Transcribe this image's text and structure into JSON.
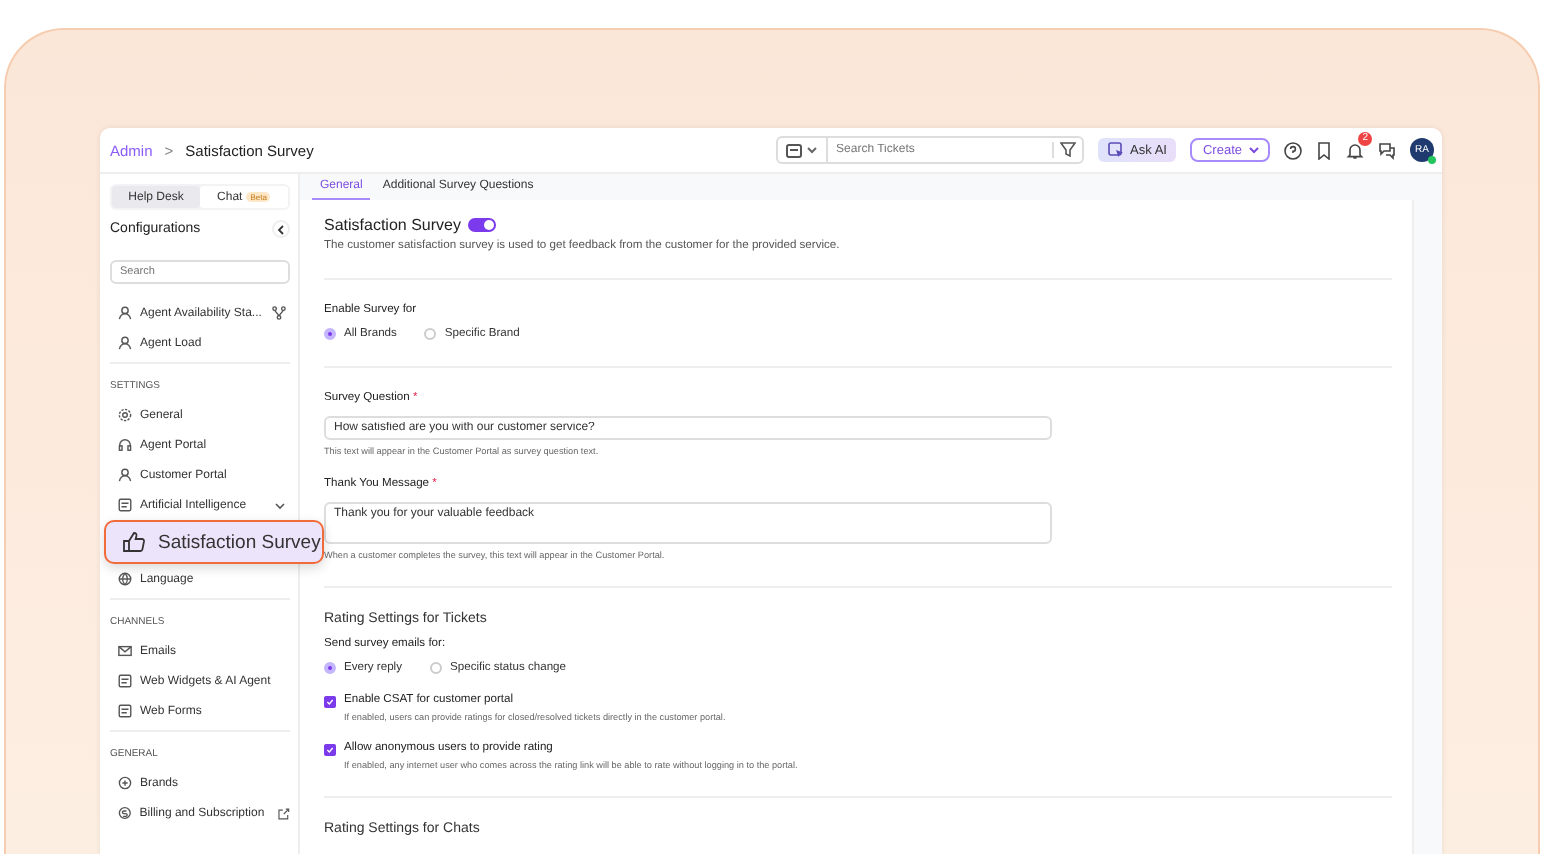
{
  "breadcrumb": {
    "parent": "Admin",
    "separator": ">",
    "current": "Satisfaction Survey"
  },
  "header": {
    "search": {
      "placeholder": "Search Tickets"
    },
    "ask_ai": "Ask AI",
    "create": "Create",
    "notifications_badge": "2",
    "avatar": {
      "initials": "RA",
      "online": true
    }
  },
  "sidebar": {
    "tabs": [
      {
        "label": "Help Desk",
        "selected": true
      },
      {
        "label": "Chat",
        "badge": "Beta",
        "selected": false
      }
    ],
    "title": "Configurations",
    "search": {
      "placeholder": "Search"
    },
    "sections": [
      {
        "items": [
          {
            "label": "Agent Availability Sta...",
            "kind": "hierarchy",
            "selected": false
          },
          {
            "label": "Agent Load",
            "kind": "plain",
            "selected": false
          }
        ]
      },
      {
        "heading": "SETTINGS",
        "items": [
          {
            "label": "General",
            "kind": "plain",
            "selected": false
          },
          {
            "label": "Agent Portal",
            "kind": "plain",
            "selected": false
          },
          {
            "label": "Customer Portal",
            "kind": "plain",
            "selected": false
          },
          {
            "label": "Artificial Intelligence",
            "kind": "expandable",
            "selected": false
          },
          {
            "label": "Satisfaction Survey",
            "selected": true
          },
          {
            "label": "Language",
            "kind": "plain",
            "selected": false
          }
        ]
      },
      {
        "heading": "CHANNELS",
        "items": [
          {
            "label": "Emails",
            "kind": "plain",
            "selected": false
          },
          {
            "label": "Web Widgets & AI Agent",
            "kind": "plain",
            "selected": false
          },
          {
            "label": "Web Forms",
            "kind": "plain",
            "selected": false
          }
        ]
      },
      {
        "heading": "GENERAL",
        "items": [
          {
            "label": "Brands",
            "kind": "plain",
            "selected": false
          },
          {
            "label": "Billing and Subscription",
            "kind": "external",
            "selected": false
          }
        ]
      }
    ]
  },
  "tabs": [
    {
      "label": "General",
      "selected": true
    },
    {
      "label": "Additional Survey Questions",
      "selected": false
    }
  ],
  "survey": {
    "title": "Satisfaction Survey",
    "enabled": true,
    "description": "The customer satisfaction survey is used to get feedback from the customer for the provided service."
  },
  "enable_survey": {
    "label": "Enable Survey for",
    "options": [
      {
        "label": "All Brands",
        "selected": true
      },
      {
        "label": "Specific Brand",
        "selected": false
      }
    ]
  },
  "fields": [
    {
      "label": "Survey Question",
      "required_mark": "*",
      "kind": "input",
      "value": "How satisfied are you with our customer service?",
      "hint": "This text will appear in the Customer Portal as survey question text."
    },
    {
      "label": "Thank You Message",
      "required_mark": "*",
      "kind": "textarea",
      "value": "Thank you for your valuable feedback",
      "hint": "When a customer completes the survey, this text will appear in the Customer Portal."
    }
  ],
  "ticket_rating": {
    "title": "Rating Settings for Tickets",
    "send_label": "Send survey emails for:",
    "options": [
      {
        "label": "Every reply",
        "selected": true
      },
      {
        "label": "Specific status change",
        "selected": false
      }
    ],
    "checkboxes": [
      {
        "label": "Enable CSAT for customer portal",
        "hint": "If enabled, users can provide ratings for closed/resolved tickets directly in the customer portal.",
        "checked": true
      },
      {
        "label": "Allow anonymous users to provide rating",
        "hint": "If enabled, any internet user who comes across the rating link will be able to rate without logging in to the portal.",
        "checked": true
      }
    ]
  },
  "chat_rating": {
    "title": "Rating Settings for Chats"
  }
}
